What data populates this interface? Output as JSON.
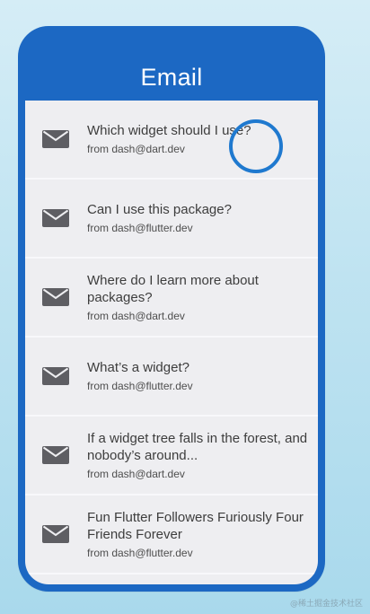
{
  "colors": {
    "app_bar": "#1c68c3",
    "list_bg": "#eeeef1",
    "icon": "#5e5e63",
    "cursor_ring": "#1f79cf"
  },
  "app_bar": {
    "title": "Email"
  },
  "emails": [
    {
      "icon": "mail-icon",
      "subject": "Which widget should I use?",
      "from": "from dash@dart.dev"
    },
    {
      "icon": "mail-icon",
      "subject": "Can I use this package?",
      "from": "from dash@flutter.dev"
    },
    {
      "icon": "mail-icon",
      "subject": "Where do I learn more about packages?",
      "from": "from dash@dart.dev"
    },
    {
      "icon": "mail-icon",
      "subject": "What’s a widget?",
      "from": "from dash@flutter.dev"
    },
    {
      "icon": "mail-icon",
      "subject": "If a widget tree falls in the forest, and nobody’s around...",
      "from": "from dash@dart.dev"
    },
    {
      "icon": "mail-icon",
      "subject": "Fun Flutter Followers Furiously Four Friends Forever",
      "from": "from dash@flutter.dev"
    }
  ],
  "watermark": "@稀土掘金技术社区"
}
